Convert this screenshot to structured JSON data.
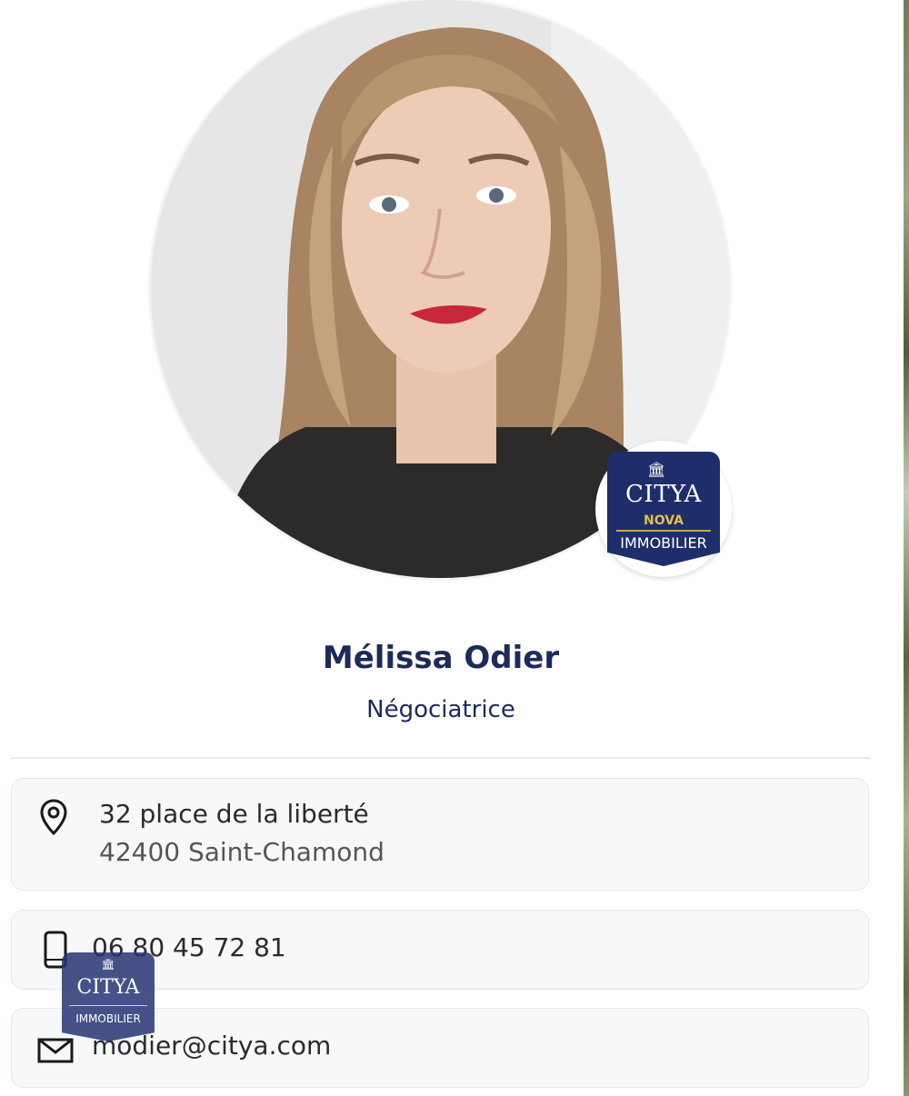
{
  "agent": {
    "name": "Mélissa Odier",
    "role": "Négociatrice"
  },
  "badge": {
    "brand": "CITYA",
    "sub_brand": "NOVA",
    "label": "IMMOBILIER"
  },
  "contact": {
    "address_line1": "32 place de la liberté",
    "address_line2": "42400 Saint-Chamond",
    "phone": "06 80 45 72 81",
    "email": "modier@citya.com"
  },
  "floating_logo": {
    "brand": "CITYA",
    "label": "IMMOBILIER"
  },
  "colors": {
    "brand_navy": "#1e2e6b",
    "text_dark_blue": "#1b2b5a",
    "gold": "#e2bf4e",
    "card_bg": "#f7f8fa"
  },
  "icons": {
    "address": "map-pin-icon",
    "phone": "smartphone-icon",
    "email": "envelope-icon"
  }
}
